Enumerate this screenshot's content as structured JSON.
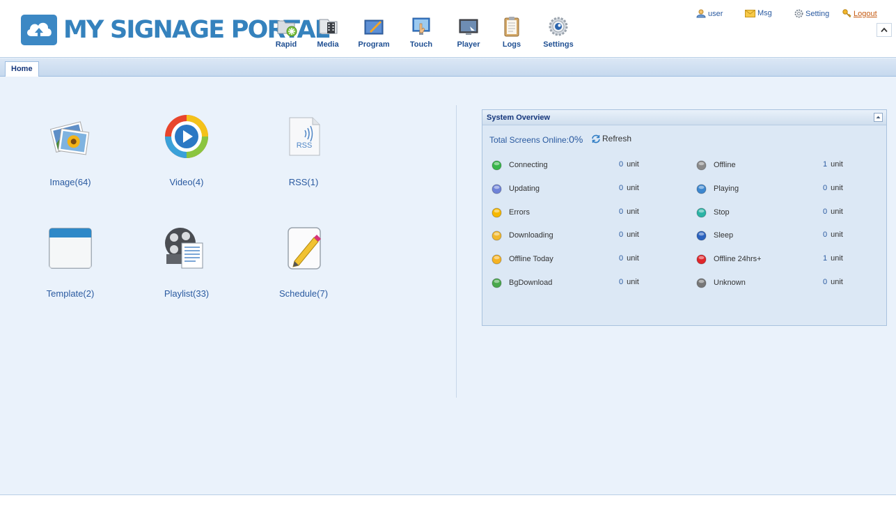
{
  "brand": {
    "logo_text": "MY SIGNAGE PORTAL"
  },
  "nav": [
    {
      "id": "rapid",
      "label": "Rapid"
    },
    {
      "id": "media",
      "label": "Media"
    },
    {
      "id": "program",
      "label": "Program"
    },
    {
      "id": "touch",
      "label": "Touch"
    },
    {
      "id": "player",
      "label": "Player"
    },
    {
      "id": "logs",
      "label": "Logs"
    },
    {
      "id": "settings",
      "label": "Settings"
    }
  ],
  "topright": {
    "user": "user",
    "msg": "Msg",
    "setting": "Setting",
    "logout": "Logout"
  },
  "tabs": [
    {
      "label": "Home"
    }
  ],
  "grid": [
    {
      "label": "Image(64)",
      "icon": "image-icon"
    },
    {
      "label": "Video(4)",
      "icon": "video-icon"
    },
    {
      "label": "RSS(1)",
      "icon": "rss-icon"
    },
    {
      "label": "Template(2)",
      "icon": "template-icon"
    },
    {
      "label": "Playlist(33)",
      "icon": "playlist-icon"
    },
    {
      "label": "Schedule(7)",
      "icon": "schedule-icon"
    }
  ],
  "overview": {
    "title": "System Overview",
    "online_label": "Total Screens Online:",
    "online_pct": "0%",
    "refresh": "Refresh",
    "unit": "unit",
    "left": [
      {
        "label": "Connecting",
        "value": "0",
        "icon": "connecting-icon",
        "color": "#39b54a"
      },
      {
        "label": "Updating",
        "value": "0",
        "icon": "updating-icon",
        "color": "#6f83d8"
      },
      {
        "label": "Errors",
        "value": "0",
        "icon": "errors-icon",
        "color": "#f6b800"
      },
      {
        "label": "Downloading",
        "value": "0",
        "icon": "downloading-icon",
        "color": "#f1b82d"
      },
      {
        "label": "Offline Today",
        "value": "0",
        "icon": "offline-today-icon",
        "color": "#f5b323"
      },
      {
        "label": "BgDownload",
        "value": "0",
        "icon": "bgdownload-icon",
        "color": "#4aa84c"
      }
    ],
    "right": [
      {
        "label": "Offline",
        "value": "1",
        "icon": "offline-icon",
        "color": "#8a8a8a"
      },
      {
        "label": "Playing",
        "value": "0",
        "icon": "playing-icon",
        "color": "#3d87cf"
      },
      {
        "label": "Stop",
        "value": "0",
        "icon": "stop-icon",
        "color": "#2bb3a5"
      },
      {
        "label": "Sleep",
        "value": "0",
        "icon": "sleep-icon",
        "color": "#2b62bf"
      },
      {
        "label": "Offline 24hrs+",
        "value": "1",
        "icon": "offline-24hrs-icon",
        "color": "#e0262b"
      },
      {
        "label": "Unknown",
        "value": "0",
        "icon": "unknown-icon",
        "color": "#777777"
      }
    ]
  }
}
